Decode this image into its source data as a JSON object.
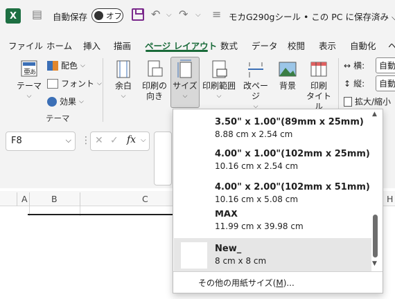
{
  "titlebar": {
    "app_logo": "X",
    "autosave_label": "自動保存",
    "autosave_state": "オフ",
    "doc_title": "モカG290gシール • この PC に保存済み ⌵"
  },
  "tabs": [
    "ファイル",
    "ホーム",
    "挿入",
    "描画",
    "ページ レイアウト",
    "数式",
    "データ",
    "校閲",
    "表示",
    "自動化",
    "ヘ"
  ],
  "active_tab": "ページ レイアウト",
  "ribbon": {
    "theme_btn": "テーマ",
    "colors": "配色",
    "fonts": "フォント",
    "effects": "効果",
    "theme_group": "テーマ",
    "margins": "余白",
    "orientation_1": "印刷の",
    "orientation_2": "向き",
    "size": "サイズ",
    "print_area": "印刷範囲",
    "breaks": "改ページ",
    "background": "背景",
    "print_titles_1": "印刷",
    "print_titles_2": "タイトル",
    "width_label": "横:",
    "height_label": "縦:",
    "width_value": "自動",
    "height_value": "自動",
    "scale_label": "拡大/縮小"
  },
  "formula_bar": {
    "name_box": "F8",
    "fx": "fx"
  },
  "columns": [
    "A",
    "B",
    "C",
    "H"
  ],
  "size_menu": {
    "items": [
      {
        "name": "3.50\" x 1.00\"(89mm x 25mm)",
        "dim": "8.88 cm x 2.54 cm"
      },
      {
        "name": "4.00\" x 1.00\"(102mm x 25mm)",
        "dim": "10.16 cm x 2.54 cm"
      },
      {
        "name": "4.00\" x 2.00\"(102mm x 51mm)",
        "dim": "10.16 cm x 5.08 cm"
      },
      {
        "name": "MAX",
        "dim": "11.99 cm x 39.98 cm"
      },
      {
        "name": "New_",
        "dim": "8 cm x 8 cm"
      }
    ],
    "more": "その他の用紙サイズ(",
    "more_key": "M",
    "more_end": ")..."
  },
  "colors": {
    "accent": "#1a6b3a",
    "excel_green": "#1d6f42",
    "save_purple": "#7b2a8c"
  }
}
